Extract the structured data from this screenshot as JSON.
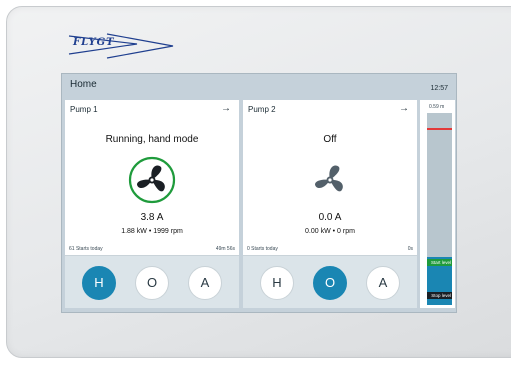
{
  "brand": {
    "logo_text": "FLYGT"
  },
  "header": {
    "title": "Home",
    "time": "12:57"
  },
  "pumps": [
    {
      "title": "Pump 1",
      "status": "Running, hand mode",
      "running": true,
      "current": "3.8 A",
      "power": "1.88 kW  •  1999 rpm",
      "starts": "61 Starts today",
      "runtime": "49m 56s",
      "modes": [
        "H",
        "O",
        "A"
      ],
      "active_mode": "H"
    },
    {
      "title": "Pump 2",
      "status": "Off",
      "running": false,
      "current": "0.0 A",
      "power": "0.00 kW  •  0 rpm",
      "starts": "0 Starts today",
      "runtime": "0s",
      "modes": [
        "H",
        "O",
        "A"
      ],
      "active_mode": "O"
    }
  ],
  "level": {
    "max_label": "0.59 m",
    "start_label": "Start level",
    "stop_label": "Stop level",
    "water_fraction": 0.25,
    "alarm_fraction": 0.92
  },
  "colors": {
    "accent": "#1a86b3",
    "running_ring": "#1f9b3c",
    "alarm_line": "#e23a3a",
    "fan_gray": "#53606a"
  },
  "icons": {
    "card_arrow": "arrow-right-icon",
    "fan": "fan-icon"
  }
}
